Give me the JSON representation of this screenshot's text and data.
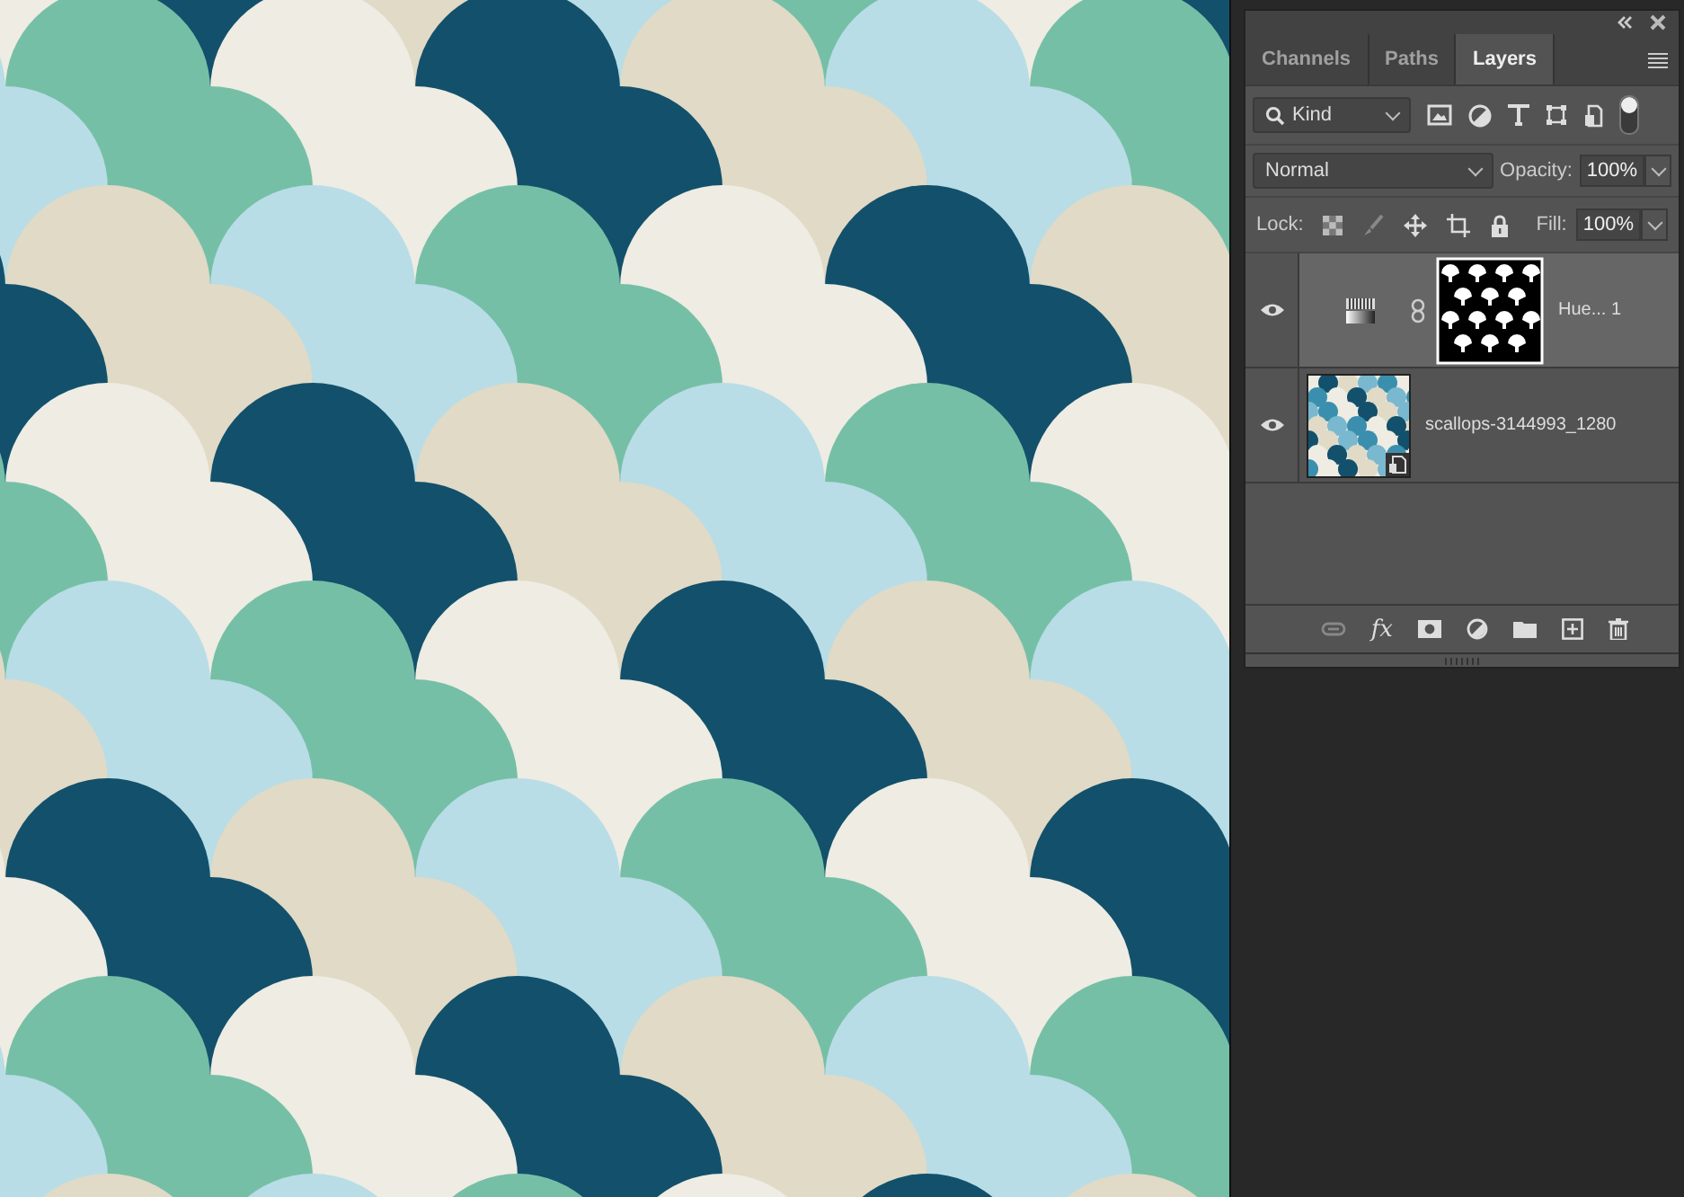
{
  "panel": {
    "tabs": [
      {
        "label": "Channels",
        "selected": false
      },
      {
        "label": "Paths",
        "selected": false
      },
      {
        "label": "Layers",
        "selected": true
      }
    ],
    "filter": {
      "value": "Kind",
      "on": true
    },
    "blend_mode": "Normal",
    "opacity": {
      "label": "Opacity:",
      "value": "100%"
    },
    "lock": {
      "label": "Lock:"
    },
    "fill": {
      "label": "Fill:",
      "value": "100%"
    },
    "effects_button": "fx",
    "layers": [
      {
        "kind": "adjustment",
        "name": "Hue... 1",
        "visible": true,
        "selected": true
      },
      {
        "kind": "smart",
        "name": "scallops-3144993_1280",
        "visible": true,
        "selected": false
      }
    ]
  }
}
